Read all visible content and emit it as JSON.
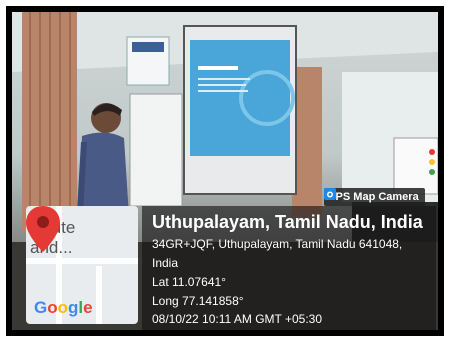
{
  "overlay": {
    "app_badge": "GPS Map Camera",
    "title": "Uthupalayam, Tamil Nadu, India",
    "address_line1": "34GR+JQF, Uthupalayam, Tamil Nadu 641048,",
    "address_line2": "India",
    "lat": "Lat 11.07641°",
    "long": "Long 77.141858°",
    "timestamp": "08/10/22 10:11 AM GMT +05:30"
  },
  "map": {
    "label_line1": "stitute",
    "label_line2": "and...",
    "brand": "Google",
    "pin_color": "#e53935"
  },
  "colors": {
    "screen": "#4aa6d8",
    "curtain": "#b9856a"
  }
}
